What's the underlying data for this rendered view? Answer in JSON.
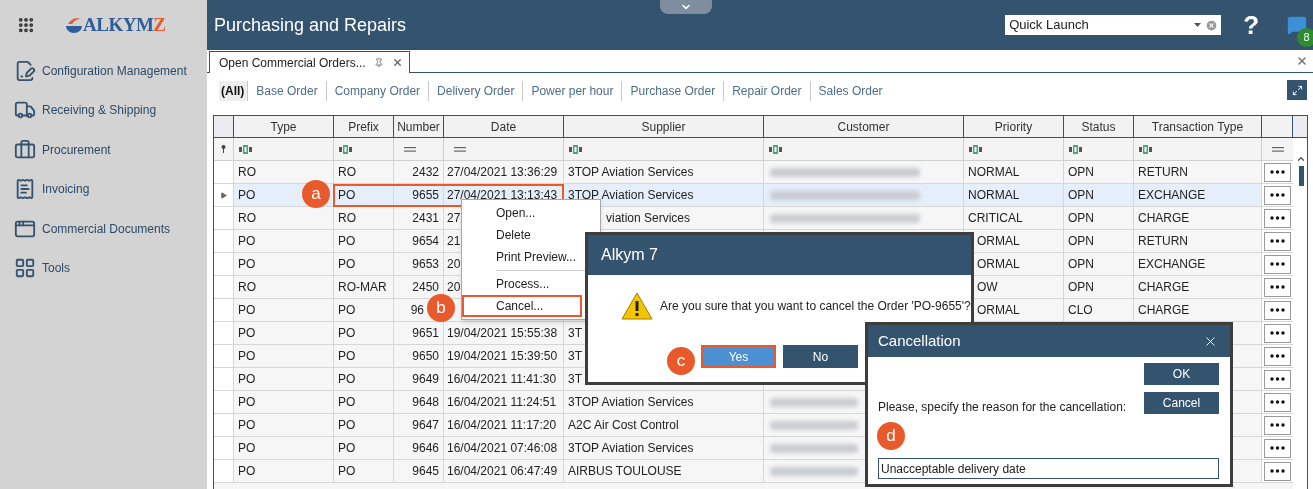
{
  "app": {
    "logo": "ALKYMZ",
    "title": "Purchasing and Repairs",
    "help": "?",
    "notifications": "8"
  },
  "quick_launch": {
    "placeholder": "Quick Launch"
  },
  "sidebar": {
    "items": [
      {
        "label": "Configuration Management",
        "kind": "config"
      },
      {
        "label": "Receiving & Shipping",
        "kind": "truck"
      },
      {
        "label": "Procurement",
        "kind": "briefcase"
      },
      {
        "label": "Invoicing",
        "kind": "invoice"
      },
      {
        "label": "Commercial Documents",
        "kind": "documents"
      },
      {
        "label": "Tools",
        "kind": "tools"
      }
    ]
  },
  "document_tab": {
    "title": "Open Commercial Orders..."
  },
  "filters": [
    {
      "label": "(All)",
      "selected": true
    },
    {
      "label": "Base Order",
      "selected": false
    },
    {
      "label": "Company Order",
      "selected": false
    },
    {
      "label": "Delivery Order",
      "selected": false
    },
    {
      "label": "Power per hour",
      "selected": false
    },
    {
      "label": "Purchase Order",
      "selected": false
    },
    {
      "label": "Repair Order",
      "selected": false
    },
    {
      "label": "Sales Order",
      "selected": false
    }
  ],
  "table": {
    "columns": [
      "Type",
      "Prefix",
      "Number",
      "Date",
      "Supplier",
      "Customer",
      "Priority",
      "Status",
      "Transaction Type"
    ],
    "filter_row": [
      {
        "kind": "text"
      },
      {
        "kind": "text"
      },
      {
        "kind": "equals"
      },
      {
        "kind": "equals"
      },
      {
        "kind": "text"
      },
      {
        "kind": "text"
      },
      {
        "kind": "text"
      },
      {
        "kind": "text"
      },
      {
        "kind": "text"
      },
      {
        "kind": "equals"
      }
    ],
    "rows": [
      {
        "type": "RO",
        "prefix": "RO",
        "number": "2432",
        "date": "27/04/2021 13:36:29",
        "supplier": "3TOP Aviation Services",
        "customer_blurred": true,
        "customer_clipped": false,
        "priority": "NORMAL",
        "status": "OPN",
        "transaction_type": "RETURN",
        "selected": false
      },
      {
        "type": "PO",
        "prefix": "PO",
        "number": "9655",
        "date": "27/04/2021 13:13:43",
        "supplier": "3TOP Aviation Services",
        "customer_blurred": true,
        "customer_clipped": false,
        "priority": "NORMAL",
        "status": "OPN",
        "transaction_type": "EXCHANGE",
        "selected": true,
        "outlined": true
      },
      {
        "type": "RO",
        "prefix": "RO",
        "number": "2431",
        "date": "27",
        "supplier": "viation Services",
        "supplier_clipped_start": true,
        "customer_blurred": true,
        "customer_clipped": false,
        "priority": "CRITICAL",
        "status": "OPN",
        "transaction_type": "CHARGE",
        "selected": false
      },
      {
        "type": "PO",
        "prefix": "PO",
        "number": "9654",
        "date": "21",
        "priority": "ORMAL",
        "priority_clipped_start": true,
        "status": "OPN",
        "transaction_type": "RETURN",
        "selected": false
      },
      {
        "type": "PO",
        "prefix": "PO",
        "number": "9653",
        "date": "20",
        "priority": "ORMAL",
        "priority_clipped_start": true,
        "status": "OPN",
        "transaction_type": "EXCHANGE",
        "selected": false
      },
      {
        "type": "RO",
        "prefix": "RO-MAR",
        "number": "2450",
        "date": "20",
        "priority": "OW",
        "priority_clipped_start": true,
        "status": "OPN",
        "transaction_type": "CHARGE",
        "selected": false
      },
      {
        "type": "PO",
        "prefix": "PO",
        "number": "96",
        "number_clipped_end": true,
        "priority": "ORMAL",
        "priority_clipped_start": true,
        "status": "CLO",
        "transaction_type": "CHARGE",
        "selected": false
      },
      {
        "type": "PO",
        "prefix": "PO",
        "number": "9651",
        "date": "19/04/2021 15:55:38",
        "supplier": "3T",
        "selected": false
      },
      {
        "type": "PO",
        "prefix": "PO",
        "number": "9650",
        "date": "19/04/2021 15:39:50",
        "supplier": "3T",
        "selected": false
      },
      {
        "type": "PO",
        "prefix": "PO",
        "number": "9649",
        "date": "16/04/2021 11:41:30",
        "supplier": "3T",
        "selected": false
      },
      {
        "type": "PO",
        "prefix": "PO",
        "number": "9648",
        "date": "16/04/2021 11:24:51",
        "supplier": "3TOP Aviation Services",
        "customer_blurred": true,
        "customer_clipped": true,
        "selected": false
      },
      {
        "type": "PO",
        "prefix": "PO",
        "number": "9647",
        "date": "16/04/2021 11:17:20",
        "supplier": "A2C Air Cost Control",
        "customer_blurred": true,
        "customer_clipped": true,
        "selected": false
      },
      {
        "type": "PO",
        "prefix": "PO",
        "number": "9646",
        "date": "16/04/2021 07:46:08",
        "supplier": "3TOP Aviation Services",
        "customer_blurred": true,
        "customer_clipped": true,
        "selected": false
      },
      {
        "type": "PO",
        "prefix": "PO",
        "number": "9645",
        "date": "16/04/2021 06:47:49",
        "supplier": "AIRBUS TOULOUSE",
        "customer_blurred": true,
        "customer_clipped": true,
        "selected": false
      }
    ]
  },
  "context_menu": {
    "items": [
      {
        "kind": "item",
        "label": "Open...",
        "outlined": false
      },
      {
        "kind": "item",
        "label": "Delete",
        "outlined": false
      },
      {
        "kind": "item",
        "label": "Print Preview...",
        "outlined": false
      },
      {
        "kind": "separator"
      },
      {
        "kind": "item",
        "label": "Process...",
        "outlined": false
      },
      {
        "kind": "item",
        "label": "Cancel...",
        "outlined": true
      }
    ]
  },
  "confirm_dialog": {
    "title": "Alkym 7",
    "message": "Are you sure that you want to cancel the Order 'PO-9655'?",
    "buttons": [
      {
        "label": "Yes",
        "focused": true,
        "outlined": true
      },
      {
        "label": "No",
        "focused": false,
        "outlined": false
      }
    ]
  },
  "cancellation_dialog": {
    "title": "Cancellation",
    "prompt": "Please, specify the reason for the cancellation:",
    "value": "Unacceptable delivery date",
    "buttons": [
      "OK",
      "Cancel"
    ]
  },
  "callouts": [
    "a",
    "b",
    "c",
    "d"
  ]
}
